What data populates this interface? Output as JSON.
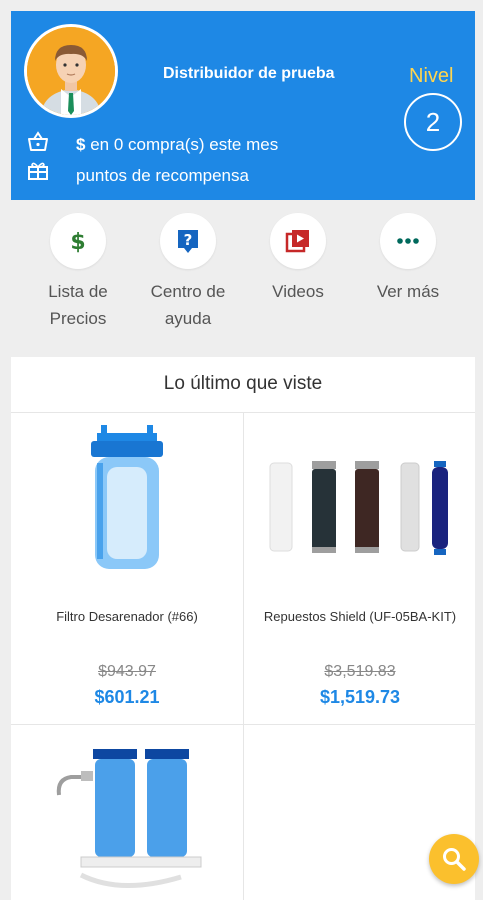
{
  "profile": {
    "name": "Distribuidor de prueba",
    "level_label": "Nivel",
    "level_value": "2",
    "purchases_amount": "$",
    "purchases_text": " en 0 compra(s) este mes",
    "points_text": "puntos de recompensa"
  },
  "quick_actions": [
    {
      "icon": "dollar-icon",
      "label_line1": "Lista de",
      "label_line2": "Precios"
    },
    {
      "icon": "help-icon",
      "label_line1": "Centro de",
      "label_line2": "ayuda"
    },
    {
      "icon": "video-icon",
      "label_line1": "Videos",
      "label_line2": ""
    },
    {
      "icon": "more-icon",
      "label_line1": "Ver más",
      "label_line2": ""
    }
  ],
  "recent": {
    "title": "Lo último que viste",
    "products": [
      {
        "name": "Filtro Desarenador (#66)",
        "old_price": "$943.97",
        "price": "$601.21"
      },
      {
        "name": "Repuestos Shield (UF-05BA-KIT)",
        "old_price": "$3,519.83",
        "price": "$1,519.73"
      }
    ]
  },
  "colors": {
    "primary": "#1e88e5",
    "level": "#ffd54f",
    "fab": "#fbc02d"
  }
}
